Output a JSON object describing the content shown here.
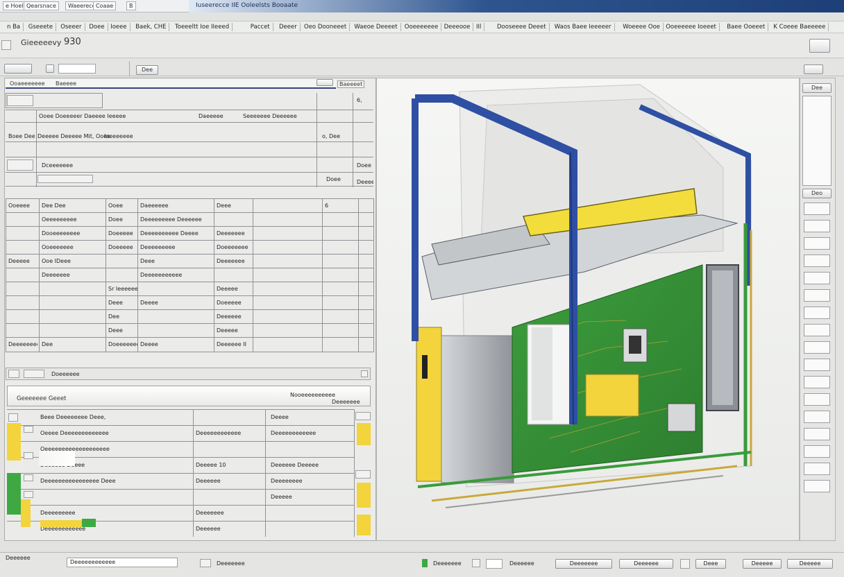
{
  "titlebar": {
    "tabs": [
      "e Hoel",
      "Qearsnace",
      "Waeerece Iaete",
      "Coaae",
      "B"
    ],
    "title": "Iuseerecce IIE Ooleelsts Booaate"
  },
  "menu": {
    "items": [
      "n Ba",
      "Gseeete",
      "Oseeer",
      "Doee",
      "Ioeee",
      "Baek, CHE",
      "Toeeeltt Ioe IIeeed",
      "Paccet",
      "Deeer",
      "Oeo Dooneeet",
      "Waeoe Deeeet",
      "Ooeeeeeee",
      "Deeeooe",
      "IIl",
      "Dooseeee Deeet",
      "Waos Baee Ieeeeer",
      "Woeeee Ooe",
      "Ooeeeeee Ioeeet",
      "Baee Ooeeet",
      "K Coeee Baeeeee"
    ]
  },
  "header": {
    "page_title": "Gieeeeevy",
    "page_number": "930",
    "tool_label": "Dee"
  },
  "left_panel": {
    "header_label": "Ooaeeeeeee",
    "header_sub": "Baeeee",
    "header_right": "Baeeeet",
    "top_rows": [
      {
        "left": "",
        "mid": "Ooee Doeeeeer Daeeee Ieeeee",
        "mid2": "Daeeeee",
        "right": "Seeeeeee Deeeeee",
        "val": "6,"
      },
      {
        "left": "Boee Dee",
        "mid": "Deeeee Deeeee Mit, Ooee",
        "mid2": "Ioeeeeeee",
        "right": "",
        "val": "o, Dee"
      },
      {
        "left": "",
        "mid": "Dceeeeeee",
        "mid2": "",
        "right": "",
        "val": "Doee"
      },
      {
        "left": "",
        "mid": "",
        "mid2": "",
        "right": "Doee",
        "val": "Deeee"
      }
    ],
    "table_rows": [
      {
        "a": "Ooeeee",
        "b": "Dee Dee",
        "c": "Ooee",
        "d": "Daeeeeee",
        "e": "Deee",
        "f": "6"
      },
      {
        "a": "",
        "b": "Oeeeeeeeee",
        "c": "Doee",
        "d": "Deeeeeeeee Deeeeee",
        "e": "",
        "f": ""
      },
      {
        "a": "",
        "b": "Dooeeeeeeee",
        "c": "Doeeeee",
        "d": "Deeeeeeeeee Deeee",
        "e": "Deeeeeee",
        "f": ""
      },
      {
        "a": "",
        "b": "Ooeeeeeee",
        "c": "Doeeeee",
        "d": "Deeeeeeeee",
        "e": "Doeeeeeee",
        "f": ""
      },
      {
        "a": "Deeeee",
        "b": "Ooe IDeee",
        "c": "",
        "d": "Deee",
        "e": "Deeeeeee",
        "f": ""
      },
      {
        "a": "",
        "b": "Deeeeeee",
        "c": "",
        "d": "Deeeeeeeeeee",
        "e": "",
        "f": ""
      },
      {
        "a": "",
        "b": "",
        "c": "Sr Ieeeeee Deeeee",
        "d": "",
        "e": "Deeeee",
        "f": ""
      },
      {
        "a": "",
        "b": "",
        "c": "Deee",
        "d": "Deeee",
        "e": "Doeeeee",
        "f": ""
      },
      {
        "a": "",
        "b": "",
        "c": "Dee",
        "d": "",
        "e": "Deeeeee",
        "f": ""
      },
      {
        "a": "",
        "b": "",
        "c": "Deee",
        "d": "",
        "e": "Deeeee",
        "f": ""
      },
      {
        "a": "Deeeeeeee",
        "b": "Dee",
        "c": "Doeeeeeeeee",
        "d": "Deeee",
        "e": "Deeeeee II",
        "f": ""
      }
    ],
    "lower_header_label": "Doeeeeee",
    "lower_title": "Geeeeeee  Geeet",
    "lower_right_1": "Nooeeeeeeeeee",
    "lower_right_2": "Deeeeeee",
    "lower_rows": [
      {
        "a": "Beee Deeeeeeee Deee,",
        "b": "",
        "c": "Deeee"
      },
      {
        "a": "Oeeee Deeeeeeeeeeeee",
        "b": "Deeeeeeeeeeee",
        "c": "Deeeeeeeeeeee"
      },
      {
        "a": "Oeeeeeeeeeeeeeeeeeee",
        "b": "",
        "c": ""
      },
      {
        "a": "Deeeeee Deeee",
        "b": "Deeeee 10",
        "c": "Deeeeee Deeeee"
      },
      {
        "a": "Deeeeeeeeeeeeeeee Deee",
        "b": "Deeeeee",
        "c": "Deeeeeeee"
      },
      {
        "a": "",
        "b": "",
        "c": "Deeeee"
      },
      {
        "a": "Deeeeeeeee",
        "b": "Deeeeeee",
        "c": ""
      },
      {
        "a": "Deeeeeeeeeeee",
        "b": "Deeeeee",
        "c": ""
      }
    ]
  },
  "right_toolbar": {
    "top_label": "Dee",
    "mid_label": "Deo"
  },
  "statusbar": {
    "left": "Deeeeee",
    "field": "Deeeeeeeeeeee",
    "mid": "Deeeeeee",
    "mid2": "Deeeeeee",
    "mid3": "Deeeeee",
    "btn1": "Deeeeeee",
    "btn2": "Deeeeee",
    "btn3": "Deee",
    "btn4": "Deeeee",
    "btn5": "Deeeee"
  },
  "colors": {
    "accent_blue": "#2e4fa3",
    "pcb_green": "#3a9b3a",
    "highlight_yellow": "#f3d43c"
  }
}
